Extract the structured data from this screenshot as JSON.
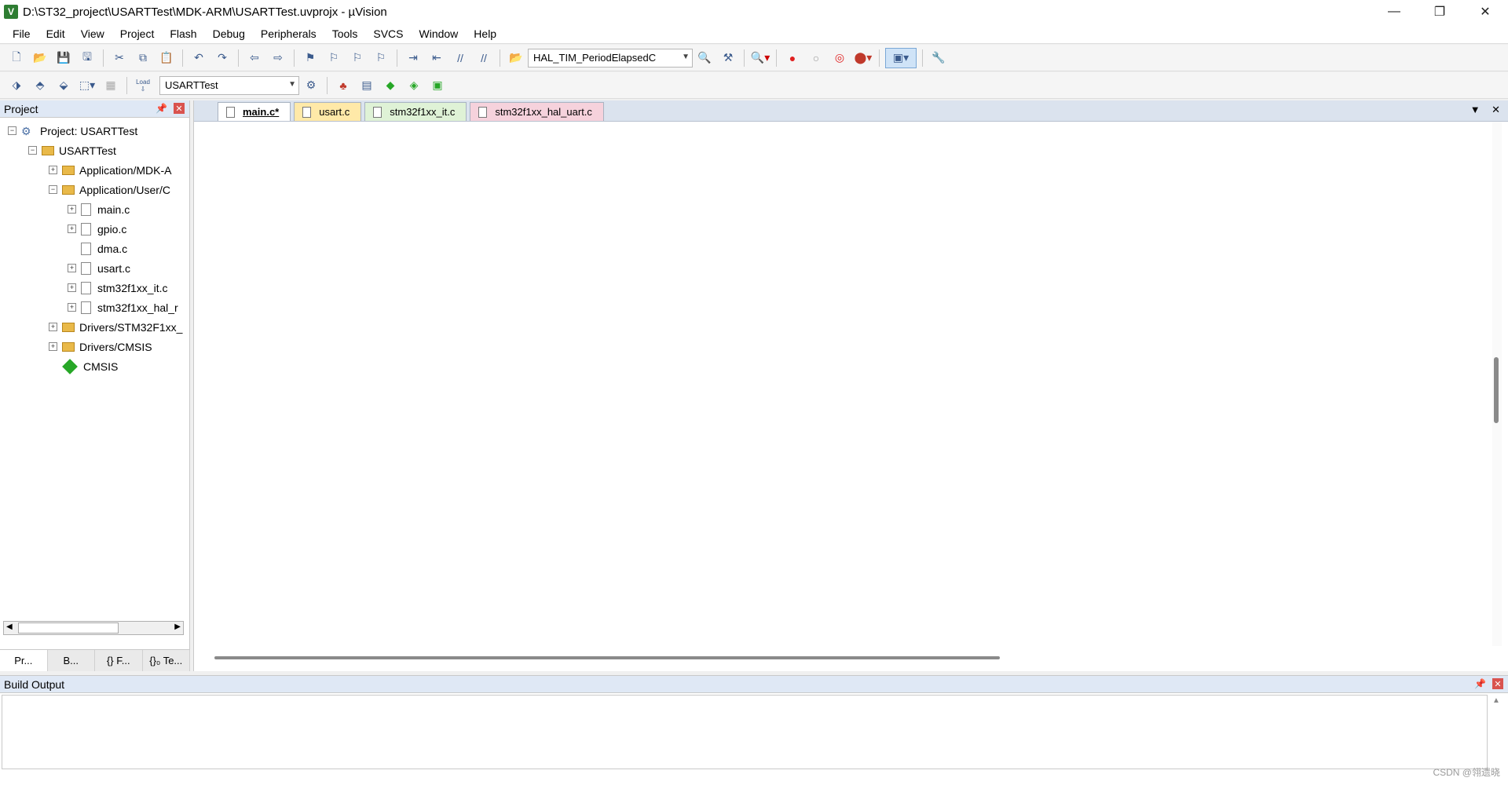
{
  "window": {
    "title": "D:\\ST32_project\\USARTTest\\MDK-ARM\\USARTTest.uvprojx - µVision",
    "minimize": "—",
    "restore": "❐",
    "close": "✕"
  },
  "menu": [
    "File",
    "Edit",
    "View",
    "Project",
    "Flash",
    "Debug",
    "Peripherals",
    "Tools",
    "SVCS",
    "Window",
    "Help"
  ],
  "toolbar1": {
    "find_combo": "HAL_TIM_PeriodElapsedC"
  },
  "toolbar2": {
    "load_label": "Load",
    "target_combo": "USARTTest"
  },
  "project_panel": {
    "title": "Project",
    "tree": [
      {
        "label": "Project: USARTTest"
      },
      {
        "label": "USARTTest"
      },
      {
        "label": "Application/MDK-A"
      },
      {
        "label": "Application/User/C"
      },
      {
        "label": "main.c"
      },
      {
        "label": "gpio.c"
      },
      {
        "label": "dma.c"
      },
      {
        "label": "usart.c"
      },
      {
        "label": "stm32f1xx_it.c"
      },
      {
        "label": "stm32f1xx_hal_r"
      },
      {
        "label": "Drivers/STM32F1xx_"
      },
      {
        "label": "Drivers/CMSIS"
      },
      {
        "label": "CMSIS"
      }
    ],
    "bottom_tabs": [
      "Pr...",
      "B...",
      "{} F...",
      "{}₀ Te..."
    ]
  },
  "editor": {
    "tabs": [
      "main.c*",
      "usart.c",
      "stm32f1xx_it.c",
      "stm32f1xx_hal_uart.c"
    ],
    "active_tab": "main.c*"
  },
  "build_output": {
    "title": "Build Output"
  },
  "watermark": "CSDN @翎遗晓"
}
